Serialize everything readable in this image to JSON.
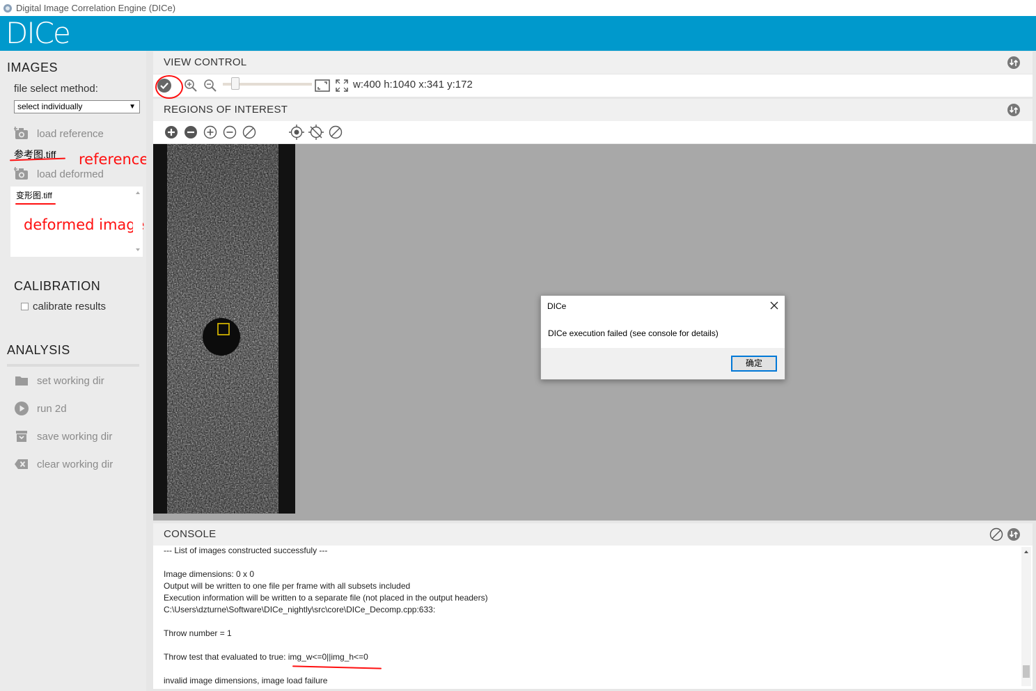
{
  "window": {
    "title": "Digital Image Correlation Engine (DICe)"
  },
  "brand": {
    "logo": "DICe",
    "color": "#0099cc"
  },
  "sidebar": {
    "images_title": "IMAGES",
    "file_select_label": "file select method:",
    "file_select_value": "select individually",
    "load_reference": "load reference",
    "reference_file": "参考图.tiff",
    "load_deformed": "load deformed",
    "deformed_files": [
      "变形图.tiff"
    ],
    "calibration_title": "CALIBRATION",
    "calibrate_label": "calibrate results",
    "analysis_title": "ANALYSIS",
    "analysis_items": [
      {
        "label": "set working dir",
        "icon": "folder-icon"
      },
      {
        "label": "run 2d",
        "icon": "play-icon"
      },
      {
        "label": "save working dir",
        "icon": "save-box-icon"
      },
      {
        "label": "clear working dir",
        "icon": "clear-x-icon"
      }
    ]
  },
  "annotations": {
    "reference": "reference image",
    "deformed": "deformed image",
    "color": "#ff1010"
  },
  "view_control": {
    "title": "VIEW CONTROL",
    "coords": "w:400 h:1040 x:341 y:172",
    "zoom_slider_level": 0.1
  },
  "roi": {
    "title": "REGIONS OF INTEREST"
  },
  "dialog": {
    "title": "DICe",
    "message": "DICe execution failed (see console for details)",
    "ok_label": "确定"
  },
  "console": {
    "title": "CONSOLE",
    "lines": [
      "--- List of images constructed successfuly ---",
      "",
      "Image dimensions: 0 x 0",
      "Output will be written to one file per frame with all subsets included",
      "Execution information will be written to a separate file (not placed in the output headers)",
      "C:\\Users\\dzturne\\Software\\DICe_nightly\\src\\core\\DICe_Decomp.cpp:633:",
      "",
      "Throw number = 1",
      "",
      "Throw test that evaluated to true: img_w<=0||img_h<=0",
      "",
      "invalid image dimensions, image load failure"
    ]
  }
}
